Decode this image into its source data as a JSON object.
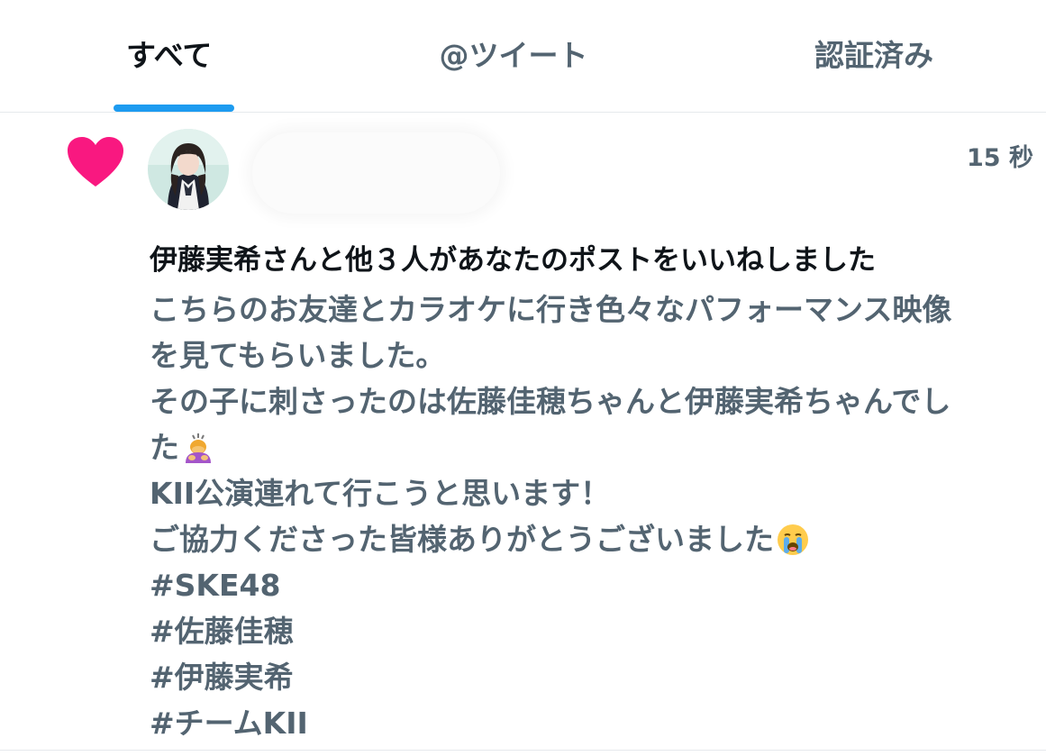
{
  "tabs": [
    {
      "label": "すべて",
      "active": true
    },
    {
      "label": "@ツイート",
      "active": false
    },
    {
      "label": "認証済み",
      "active": false
    }
  ],
  "notification": {
    "icon": "heart-icon",
    "time": "15 秒",
    "headline": "伊藤実希さんと他３人があなたのポストをいいねしました",
    "body_lines": [
      "こちらのお友達とカラオケに行き色々なパフォーマンス映像",
      "を見てもらいました。",
      "その子に刺さったのは佐藤佳穂ちゃんと伊藤実希ちゃんでし",
      "た",
      "KII公演連れて行こうと思います！",
      "ご協力くださった皆様ありがとうございました",
      "#SKE48",
      "#佐藤佳穂",
      "#伊藤実希",
      "#チームKII"
    ],
    "emojis": [
      "bowing-person-emoji",
      "crying-face-emoji"
    ]
  },
  "colors": {
    "accent": "#1d9bf0",
    "heart": "#f91880",
    "primary_text": "#0f1419",
    "secondary_text": "#536471"
  }
}
